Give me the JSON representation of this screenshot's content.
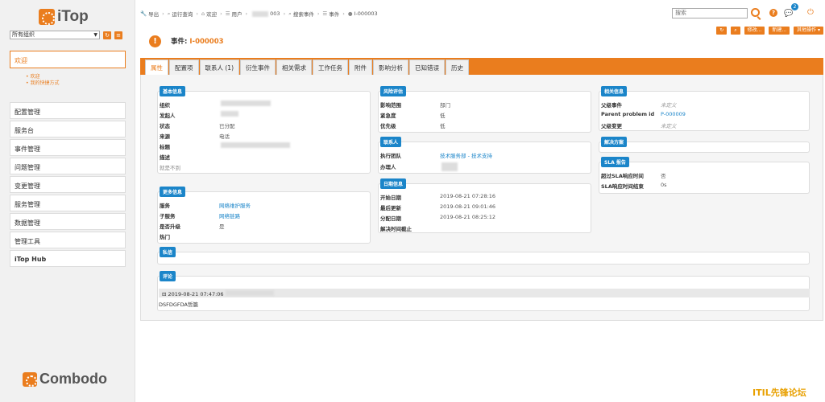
{
  "brand": {
    "name": "iTop",
    "footer": "Combodo"
  },
  "org": {
    "selected": "所有组织"
  },
  "sidebar": {
    "welcome": "欢迎",
    "welcome_links": [
      "欢迎",
      "我的快捷方式"
    ],
    "groups": [
      "配置管理",
      "服务台",
      "事件管理",
      "问题管理",
      "变更管理",
      "服务管理",
      "数据管理",
      "管理工具",
      "iTop Hub"
    ]
  },
  "breadcrumb": [
    "导出",
    "运行查询",
    "欢迎",
    "用户",
    "003",
    "搜索事件",
    "事件",
    "I-000003"
  ],
  "search": {
    "placeholder": "搜索"
  },
  "notifications": {
    "count": "2"
  },
  "object": {
    "type_label": "事件:",
    "ref": "I-000003"
  },
  "actions": [
    "修改...",
    "新建...",
    "其他操作 ▾"
  ],
  "tabs": [
    "属性",
    "配置项",
    "联系人 (1)",
    "衍生事件",
    "相关需求",
    "工作任务",
    "附件",
    "影响分析",
    "已知错误",
    "历史"
  ],
  "basic_info": {
    "title": "基本信息",
    "fields": [
      {
        "label": "组织",
        "value": ""
      },
      {
        "label": "发起人",
        "value": ""
      },
      {
        "label": "状态",
        "value": "已分配"
      },
      {
        "label": "来源",
        "value": "电话"
      },
      {
        "label": "标题",
        "value": ""
      },
      {
        "label": "描述",
        "value": ""
      }
    ],
    "note": "就是不到"
  },
  "more_info": {
    "title": "更多信息",
    "fields": [
      {
        "label": "服务",
        "value": "网络维护服务"
      },
      {
        "label": "子服务",
        "value": "网络链路"
      },
      {
        "label": "是否升级",
        "value": "是"
      },
      {
        "label": "热门",
        "value": ""
      }
    ]
  },
  "risk": {
    "title": "风险评估",
    "fields": [
      {
        "label": "影响范围",
        "value": "部门"
      },
      {
        "label": "紧急度",
        "value": "低"
      },
      {
        "label": "优先级",
        "value": "低"
      }
    ]
  },
  "contacts": {
    "title": "联系人",
    "fields": [
      {
        "label": "执行团队",
        "value": "技术服务部 - 技术支持"
      },
      {
        "label": "办理人",
        "value": ""
      }
    ]
  },
  "dates": {
    "title": "日期信息",
    "fields": [
      {
        "label": "开始日期",
        "value": "2019-08-21 07:28:16"
      },
      {
        "label": "最后更新",
        "value": "2019-08-21 09:01:46"
      },
      {
        "label": "分配日期",
        "value": "2019-08-21 08:25:12"
      },
      {
        "label": "解决时间截止",
        "value": ""
      }
    ]
  },
  "related": {
    "title": "相关信息",
    "fields": [
      {
        "label": "父级事件",
        "value": "未定义"
      },
      {
        "label": "Parent problem id",
        "value": "P-000009"
      },
      {
        "label": "父级变更",
        "value": "未定义"
      }
    ]
  },
  "solution": {
    "title": "解决方案"
  },
  "sla": {
    "title": "SLA 报告",
    "fields": [
      {
        "label": "超过SLA响应时间",
        "value": "否"
      },
      {
        "label": "SLA响应时间结束",
        "value": "0s"
      }
    ]
  },
  "private": {
    "title": "私信"
  },
  "comments": {
    "title": "评论",
    "entry_time": "2019-08-21 07:47:06",
    "entry_text": "DSFDGFDA哲篇"
  },
  "watermark": "ITIL先锋论坛"
}
